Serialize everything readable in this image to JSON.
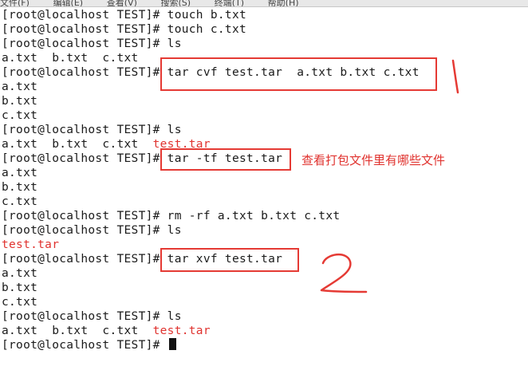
{
  "menubar": {
    "items": [
      "文件(F)",
      "编辑(E)",
      "查看(V)",
      "搜索(S)",
      "终端(T)",
      "帮助(H)"
    ]
  },
  "terminal": {
    "lines": [
      {
        "text": "[root@localhost TEST]# touch b.txt"
      },
      {
        "text": "[root@localhost TEST]# touch c.txt"
      },
      {
        "text": "[root@localhost TEST]# ls"
      },
      {
        "text": "a.txt  b.txt  c.txt"
      },
      {
        "text": "[root@localhost TEST]# tar cvf test.tar  a.txt b.txt c.txt"
      },
      {
        "text": "a.txt"
      },
      {
        "text": "b.txt"
      },
      {
        "text": "c.txt"
      },
      {
        "text": "[root@localhost TEST]# ls"
      },
      {
        "text": "a.txt  b.txt  c.txt  ",
        "red": "test.tar"
      },
      {
        "text": "[root@localhost TEST]# tar -tf test.tar"
      },
      {
        "text": "a.txt"
      },
      {
        "text": "b.txt"
      },
      {
        "text": "c.txt"
      },
      {
        "text": "[root@localhost TEST]# rm -rf a.txt b.txt c.txt"
      },
      {
        "text": "[root@localhost TEST]# ls"
      },
      {
        "text": "",
        "red": "test.tar"
      },
      {
        "text": "[root@localhost TEST]# tar xvf test.tar"
      },
      {
        "text": "a.txt"
      },
      {
        "text": "b.txt"
      },
      {
        "text": "c.txt"
      },
      {
        "text": "[root@localhost TEST]# ls"
      },
      {
        "text": "a.txt  b.txt  c.txt  ",
        "red": "test.tar"
      },
      {
        "text": "[root@localhost TEST]# ",
        "cursor": true
      }
    ]
  },
  "annotations": {
    "note_tf": "查看打包文件里有哪些文件"
  },
  "colors": {
    "annotation_red": "#e53a34",
    "archive_red": "#e0332f",
    "text": "#1a1a1a",
    "background": "#ffffff"
  }
}
